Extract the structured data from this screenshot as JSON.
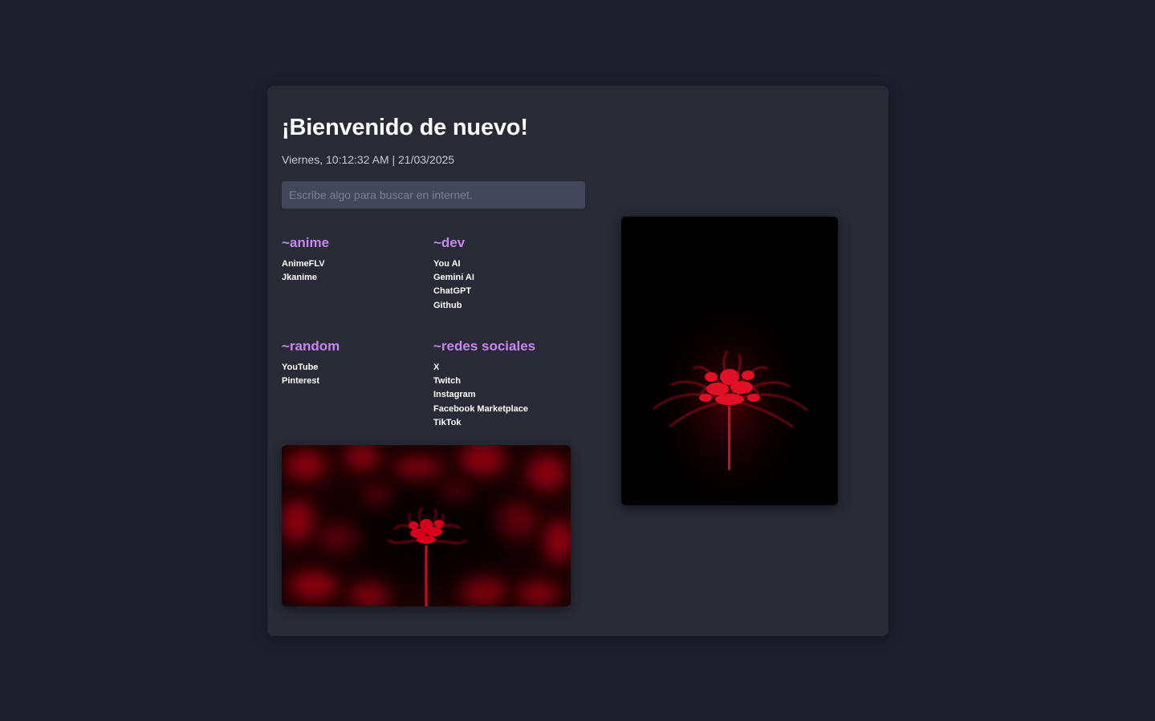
{
  "header": {
    "title": "¡Bienvenido de nuevo!",
    "datetime": "Viernes, 10:12:32 AM | 21/03/2025"
  },
  "search": {
    "placeholder": "Escribe algo para buscar en internet."
  },
  "sections": {
    "anime": {
      "title": "~anime",
      "links": [
        "AnimeFLV",
        "Jkanime"
      ]
    },
    "dev": {
      "title": "~dev",
      "links": [
        "You AI",
        "Gemini AI",
        "ChatGPT",
        "Github"
      ]
    },
    "random": {
      "title": "~random",
      "links": [
        "YouTube",
        "Pinterest"
      ]
    },
    "social": {
      "title": "~redes sociales",
      "links": [
        "X",
        "Twitch",
        "Instagram",
        "Facebook Marketplace",
        "TikTok"
      ]
    }
  },
  "colors": {
    "page_background": "#1f1e2d",
    "card_background": "#282a36",
    "accent": "#c886f0",
    "input_background": "#44475a",
    "flower_red": "#e0102a"
  }
}
